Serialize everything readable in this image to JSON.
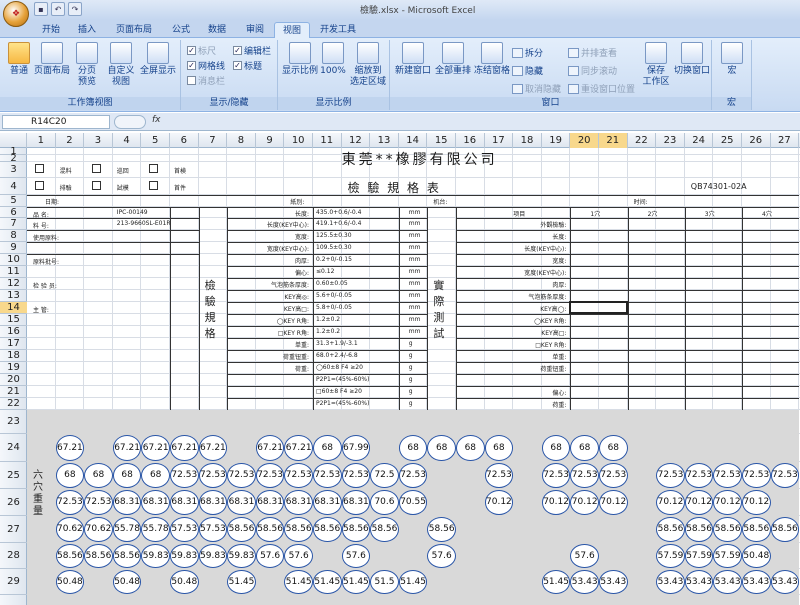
{
  "app": {
    "title": "檢驗.xlsx - Microsoft Excel",
    "office_button": "Office"
  },
  "tabs": [
    "开始",
    "插入",
    "页面布局",
    "公式",
    "数据",
    "审阅",
    "视图",
    "开发工具"
  ],
  "active_tab": "视图",
  "ribbon": {
    "groups": [
      {
        "label": "工作簿视图",
        "buttons": [
          "普通",
          "页面布局",
          "分页\n预览",
          "自定义\n视图",
          "全屏显示"
        ]
      },
      {
        "label": "显示/隐藏",
        "checks": [
          {
            "label": "标尺",
            "checked": true,
            "disabled": true
          },
          {
            "label": "网格线",
            "checked": true
          },
          {
            "label": "消息栏",
            "checked": false,
            "disabled": true
          },
          {
            "label": "编辑栏",
            "checked": true
          },
          {
            "label": "标题",
            "checked": true
          }
        ]
      },
      {
        "label": "显示比例",
        "buttons": [
          "显示比例",
          "100%",
          "缩放到\n选定区域"
        ]
      },
      {
        "label": "窗口",
        "buttons": [
          "新建窗口",
          "全部重排",
          "冻结窗格"
        ],
        "small": [
          "拆分",
          "隐藏",
          "取消隐藏",
          "并排查看",
          "同步滚动",
          "重设窗口位置"
        ],
        "extra": [
          "保存\n工作区",
          "切换窗口"
        ]
      },
      {
        "label": "宏",
        "buttons": [
          "宏"
        ]
      }
    ]
  },
  "formula_bar": {
    "name_box": "R14C20",
    "fx": "fx",
    "value": ""
  },
  "columns": [
    "1",
    "2",
    "3",
    "4",
    "5",
    "6",
    "7",
    "8",
    "9",
    "10",
    "11",
    "12",
    "13",
    "14",
    "15",
    "16",
    "17",
    "18",
    "19",
    "20",
    "21",
    "22",
    "23",
    "24",
    "25",
    "26",
    "27"
  ],
  "highlighted_columns": [
    "20",
    "21"
  ],
  "rows": [
    "1",
    "2",
    "3",
    "4",
    "5",
    "6",
    "7",
    "8",
    "9",
    "10",
    "11",
    "12",
    "13",
    "14",
    "15",
    "16",
    "17",
    "18",
    "19",
    "20",
    "21",
    "22",
    "23",
    "24",
    "25",
    "26",
    "27",
    "28",
    "29"
  ],
  "highlighted_row": "14",
  "sheet": {
    "company": "東莞**橡膠有限公司",
    "form_title": "檢  驗  規  格  表",
    "form_code": "QB74301-02A",
    "checkboxes": [
      "混料",
      "巡回",
      "首検",
      "排驗",
      "試模",
      "首件"
    ],
    "row5": {
      "a": "日期:",
      "b": "机台:",
      "c": "紙別:",
      "d": "时间:"
    },
    "left_labels": [
      {
        "k": "品    名:",
        "v": "IPC-00149"
      },
      {
        "k": "料    号:",
        "v": "213-9660SL-E01R"
      },
      {
        "k": "使用原料:",
        "v": ""
      },
      {
        "k": "原料批号:",
        "v": ""
      },
      {
        "k": "检 验 员:",
        "v": ""
      },
      {
        "k": "主    管:",
        "v": ""
      }
    ],
    "vertical_left": "檢驗規格",
    "vertical_right": "實際測試",
    "spec_rows": [
      {
        "name": "长度:",
        "value": "435.0+0.6/-0.4",
        "unit": "mm"
      },
      {
        "name": "长度(KEY中心):",
        "value": "419.1+0.6/-0.4",
        "unit": "mm"
      },
      {
        "name": "宽度:",
        "value": "125.5±0.30",
        "unit": "mm"
      },
      {
        "name": "宽度(KEY中心):",
        "value": "109.5±0.30",
        "unit": "mm"
      },
      {
        "name": "肉厚:",
        "value": "0.2+0/-0.15",
        "unit": "mm"
      },
      {
        "name": "偏心:",
        "value": "≤0.12",
        "unit": "mm"
      },
      {
        "name": "气泡筋条厚度:",
        "value": "0.60±0.05",
        "unit": "mm"
      },
      {
        "name": "KEY高◎:",
        "value": "5.6+0/-0.05",
        "unit": "mm"
      },
      {
        "name": "KEY高□:",
        "value": "5.8+0/-0.05",
        "unit": "mm"
      },
      {
        "name": "◯KEY R角:",
        "value": "1.2±0.2",
        "unit": "mm"
      },
      {
        "name": "□KEY R角:",
        "value": "1.2±0.2",
        "unit": "mm"
      },
      {
        "name": "单重:",
        "value": "31.3+1.9/-3.1",
        "unit": "g"
      },
      {
        "name": "荷重钮重:",
        "value": "68.0+2.4/-6.8",
        "unit": "g"
      },
      {
        "name": "荷重:",
        "value": "◯60±8   F4 ≥20",
        "unit": "g"
      },
      {
        "name": "",
        "value": "P2P1=(45%-60%)",
        "unit": "g"
      },
      {
        "name": "",
        "value": "□60±8   F4 ≥20",
        "unit": "g"
      },
      {
        "name": "",
        "value": "P2P1=(45%-60%)",
        "unit": "g"
      }
    ],
    "test_header": {
      "item": "项目",
      "c1": "1穴",
      "c2": "2穴",
      "c3": "3穴",
      "c4": "4穴"
    },
    "test_items": [
      "外觀檢驗:",
      "长度:",
      "长度(KEY中心):",
      "宽度:",
      "宽度(KEY中心):",
      "肉厚:",
      "气泡筋条厚度:",
      "KEY高◯:",
      "◯KEY R角:",
      "KEY高□:",
      "□KEY R角:",
      "单重:",
      "荷重钮重:",
      "",
      "偏心:",
      "荷重:"
    ],
    "vertical_weight": "六穴重量",
    "weights": {
      "r24": [
        [
          "67.21",
          1
        ],
        [
          "67.21",
          3
        ],
        [
          "67.21",
          4
        ],
        [
          "67.21",
          5
        ],
        [
          "67.21",
          6
        ],
        [
          "67.21",
          8
        ],
        [
          "67.21",
          9
        ],
        [
          "68",
          10
        ],
        [
          "67.99",
          11
        ],
        [
          "68",
          13
        ],
        [
          "68",
          14
        ],
        [
          "68",
          15
        ],
        [
          "68",
          16
        ],
        [
          "68",
          18
        ],
        [
          "68",
          19
        ],
        [
          "68",
          20
        ]
      ],
      "r25": [
        [
          "68",
          1
        ],
        [
          "68",
          2
        ],
        [
          "68",
          3
        ],
        [
          "68",
          4
        ],
        [
          "72.53",
          5
        ],
        [
          "72.53",
          6
        ],
        [
          "72.53",
          7
        ],
        [
          "72.53",
          8
        ],
        [
          "72.53",
          9
        ],
        [
          "72.53",
          10
        ],
        [
          "72.53",
          11
        ],
        [
          "72.5",
          12
        ],
        [
          "72.53",
          13
        ],
        [
          "72.53",
          16
        ],
        [
          "72.53",
          18
        ],
        [
          "72.53",
          19
        ],
        [
          "72.53",
          20
        ],
        [
          "72.53",
          22
        ],
        [
          "72.53",
          23
        ],
        [
          "72.53",
          24
        ],
        [
          "72.53",
          25
        ],
        [
          "72.53",
          26
        ]
      ],
      "r26": [
        [
          "72.53",
          1
        ],
        [
          "72.53",
          2
        ],
        [
          "68.31",
          3
        ],
        [
          "68.31",
          4
        ],
        [
          "68.31",
          5
        ],
        [
          "68.31",
          6
        ],
        [
          "68.31",
          7
        ],
        [
          "68.31",
          8
        ],
        [
          "68.31",
          9
        ],
        [
          "68.31",
          10
        ],
        [
          "68.31",
          11
        ],
        [
          "70.6",
          12
        ],
        [
          "70.55",
          13
        ],
        [
          "70.12",
          16
        ],
        [
          "70.12",
          18
        ],
        [
          "70.12",
          19
        ],
        [
          "70.12",
          20
        ],
        [
          "70.12",
          22
        ],
        [
          "70.12",
          23
        ],
        [
          "70.12",
          24
        ],
        [
          "70.12",
          25
        ]
      ],
      "r27": [
        [
          "70.62",
          1
        ],
        [
          "70.62",
          2
        ],
        [
          "55.78",
          3
        ],
        [
          "55.78",
          4
        ],
        [
          "57.53",
          5
        ],
        [
          "57.53",
          6
        ],
        [
          "58.56",
          7
        ],
        [
          "58.56",
          8
        ],
        [
          "58.56",
          9
        ],
        [
          "58.56",
          10
        ],
        [
          "58.56",
          11
        ],
        [
          "58.56",
          12
        ],
        [
          "58.56",
          14
        ],
        [
          "58.56",
          22
        ],
        [
          "58.56",
          23
        ],
        [
          "58.56",
          24
        ],
        [
          "58.56",
          25
        ],
        [
          "58.56",
          26
        ]
      ],
      "r28": [
        [
          "58.56",
          1
        ],
        [
          "58.56",
          2
        ],
        [
          "58.56",
          3
        ],
        [
          "59.83",
          4
        ],
        [
          "59.83",
          5
        ],
        [
          "59.83",
          6
        ],
        [
          "59.83",
          7
        ],
        [
          "57.6",
          8
        ],
        [
          "57.6",
          9
        ],
        [
          "57.6",
          11
        ],
        [
          "57.6",
          14
        ],
        [
          "57.6",
          19
        ],
        [
          "57.59",
          22
        ],
        [
          "57.59",
          23
        ],
        [
          "57.59",
          24
        ],
        [
          "50.48",
          25
        ]
      ],
      "r29": [
        [
          "50.48",
          1
        ],
        [
          "50.48",
          3
        ],
        [
          "50.48",
          5
        ],
        [
          "51.45",
          7
        ],
        [
          "51.45",
          9
        ],
        [
          "51.45",
          10
        ],
        [
          "51.45",
          11
        ],
        [
          "51.5",
          12
        ],
        [
          "51.45",
          13
        ],
        [
          "51.45",
          18
        ],
        [
          "53.43",
          19
        ],
        [
          "53.43",
          20
        ],
        [
          "53.43",
          22
        ],
        [
          "53.43",
          23
        ],
        [
          "53.43",
          24
        ],
        [
          "53.43",
          25
        ],
        [
          "53.43",
          26
        ]
      ]
    }
  }
}
